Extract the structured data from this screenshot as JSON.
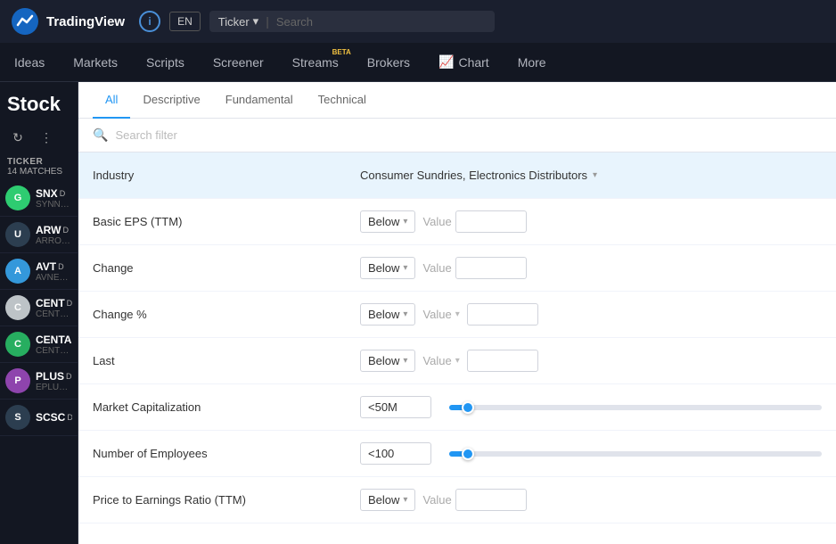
{
  "topbar": {
    "logo_text": "TradingView",
    "info_icon": "i",
    "lang": "EN",
    "ticker_label": "Ticker",
    "search_placeholder": "Search"
  },
  "nav": {
    "items": [
      {
        "id": "ideas",
        "label": "Ideas",
        "active": false
      },
      {
        "id": "markets",
        "label": "Markets",
        "active": false
      },
      {
        "id": "scripts",
        "label": "Scripts",
        "active": false
      },
      {
        "id": "screener",
        "label": "Screener",
        "active": false
      },
      {
        "id": "streams",
        "label": "Streams",
        "active": false,
        "beta": true
      },
      {
        "id": "brokers",
        "label": "Brokers",
        "active": false
      },
      {
        "id": "chart",
        "label": "Chart",
        "active": false,
        "icon": true
      },
      {
        "id": "more",
        "label": "More",
        "active": false
      }
    ]
  },
  "left_panel": {
    "title": "Stock",
    "ticker_label": "TICKER",
    "matches_label": "14 MATCHES",
    "stocks": [
      {
        "sym": "SNX",
        "badge": "D",
        "name": "SYNNEX C",
        "color": "#2ecc71",
        "letter": "G"
      },
      {
        "sym": "ARW",
        "badge": "D",
        "name": "ARROW E",
        "color": "#2c3e50",
        "letter": "U"
      },
      {
        "sym": "AVT",
        "badge": "D",
        "name": "AVNET IN",
        "color": "#3498db",
        "letter": "A"
      },
      {
        "sym": "CENT",
        "badge": "D",
        "name": "CENTRAL",
        "color": "#bdc3c7",
        "letter": "C"
      },
      {
        "sym": "CENTA",
        "badge": "",
        "name": "CENTRAL",
        "color": "#27ae60",
        "letter": "C"
      },
      {
        "sym": "PLUS",
        "badge": "D",
        "name": "EPLUS INC",
        "color": "#8e44ad",
        "letter": "P"
      },
      {
        "sym": "SCSC",
        "badge": "D",
        "name": "",
        "color": "#2c3e50",
        "letter": "S"
      }
    ]
  },
  "filter_panel": {
    "tabs": [
      {
        "id": "all",
        "label": "All",
        "active": true
      },
      {
        "id": "descriptive",
        "label": "Descriptive",
        "active": false
      },
      {
        "id": "fundamental",
        "label": "Fundamental",
        "active": false
      },
      {
        "id": "technical",
        "label": "Technical",
        "active": false
      }
    ],
    "search_placeholder": "Search filter",
    "rows": [
      {
        "id": "industry",
        "label": "Industry",
        "type": "dropdown_value",
        "value": "Consumer Sundries, Electronics Distributors",
        "highlighted": true
      },
      {
        "id": "basic_eps",
        "label": "Basic EPS (TTM)",
        "type": "below_value",
        "condition": "Below",
        "value_placeholder": "Value",
        "highlighted": false
      },
      {
        "id": "change",
        "label": "Change",
        "type": "below_value",
        "condition": "Below",
        "value_placeholder": "Value",
        "highlighted": false
      },
      {
        "id": "change_pct",
        "label": "Change %",
        "type": "below_value_chevron",
        "condition": "Below",
        "value_placeholder": "Value",
        "highlighted": false
      },
      {
        "id": "last",
        "label": "Last",
        "type": "below_value_chevron",
        "condition": "Below",
        "value_placeholder": "Value",
        "highlighted": false
      },
      {
        "id": "market_cap",
        "label": "Market Capitalization",
        "type": "slider",
        "input_value": "<50M",
        "slider_pct": 5,
        "highlighted": false
      },
      {
        "id": "num_employees",
        "label": "Number of Employees",
        "type": "slider",
        "input_value": "<100",
        "slider_pct": 5,
        "highlighted": false
      },
      {
        "id": "pe_ratio",
        "label": "Price to Earnings Ratio (TTM)",
        "type": "below_value",
        "condition": "Below",
        "value_placeholder": "Value",
        "highlighted": false
      }
    ]
  }
}
